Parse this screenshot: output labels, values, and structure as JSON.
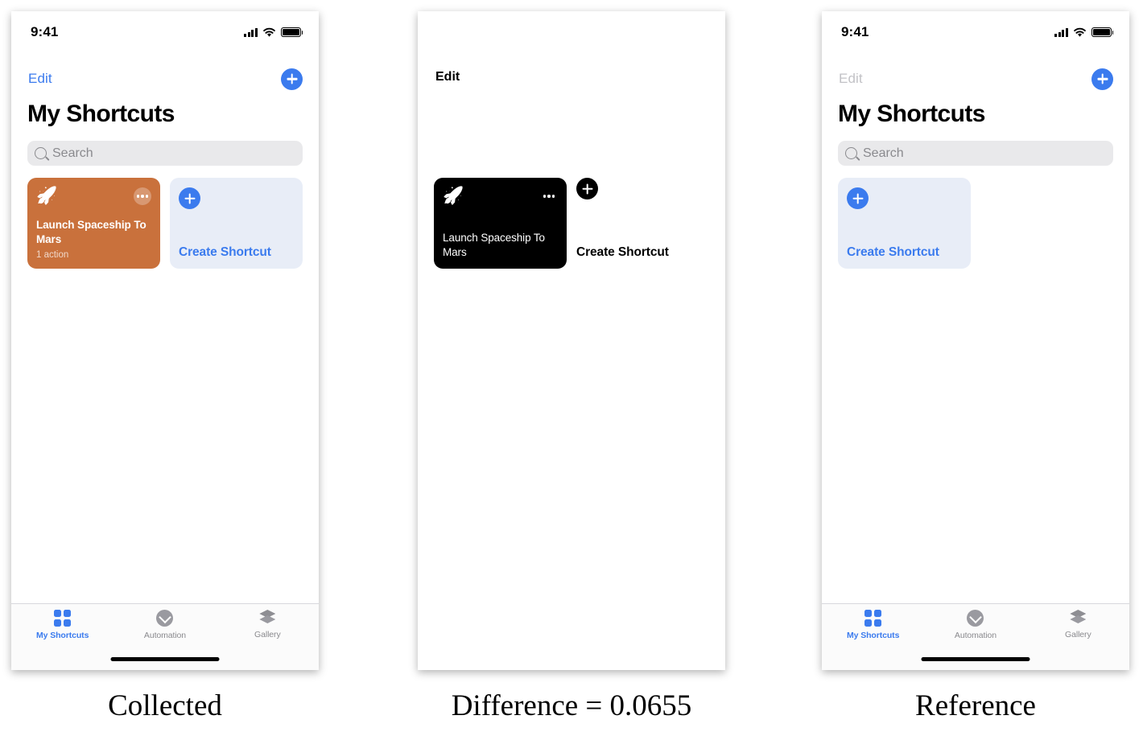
{
  "captions": {
    "collected": "Collected",
    "difference": "Difference = 0.0655",
    "reference": "Reference"
  },
  "status_bar": {
    "time": "9:41",
    "signal_icon": "cellular-signal-icon",
    "wifi_icon": "wifi-icon",
    "battery_icon": "battery-full-icon"
  },
  "nav": {
    "edit_label": "Edit",
    "add_icon": "plus-circle-icon"
  },
  "page": {
    "title": "My Shortcuts"
  },
  "search": {
    "placeholder": "Search",
    "value": "",
    "icon": "search-icon"
  },
  "collected": {
    "edit_label": "Edit",
    "edit_color": "#3B7BEE",
    "shortcut_card": {
      "icon": "rocket-icon",
      "menu_icon": "ellipsis-icon",
      "title": "Launch Spaceship To Mars",
      "subtitle": "1 action",
      "background_color": "#C9713C"
    },
    "create_card": {
      "icon": "plus-circle-icon",
      "label": "Create Shortcut",
      "background_color": "#E8EDF7",
      "accent_color": "#3B7BEE"
    }
  },
  "difference": {
    "edit_label": "Edit",
    "shortcut_card": {
      "icon": "rocket-icon",
      "menu_icon": "ellipsis-icon",
      "title": "Launch Spaceship To Mars",
      "background_color": "#000000"
    },
    "create_card": {
      "icon": "plus-circle-icon",
      "label": "Create Shortcut"
    }
  },
  "reference": {
    "edit_label": "Edit",
    "edit_color": "#C2C2C6",
    "create_card": {
      "icon": "plus-circle-icon",
      "label": "Create Shortcut",
      "background_color": "#E8EDF7",
      "accent_color": "#3B7BEE"
    }
  },
  "tab_bar": {
    "items": [
      {
        "label": "My Shortcuts",
        "icon": "grid-squares-icon",
        "active": true
      },
      {
        "label": "Automation",
        "icon": "clock-chevron-icon",
        "active": false
      },
      {
        "label": "Gallery",
        "icon": "layers-icon",
        "active": false
      }
    ],
    "active_color": "#3B7BEE",
    "inactive_color": "#8A8A8E"
  }
}
